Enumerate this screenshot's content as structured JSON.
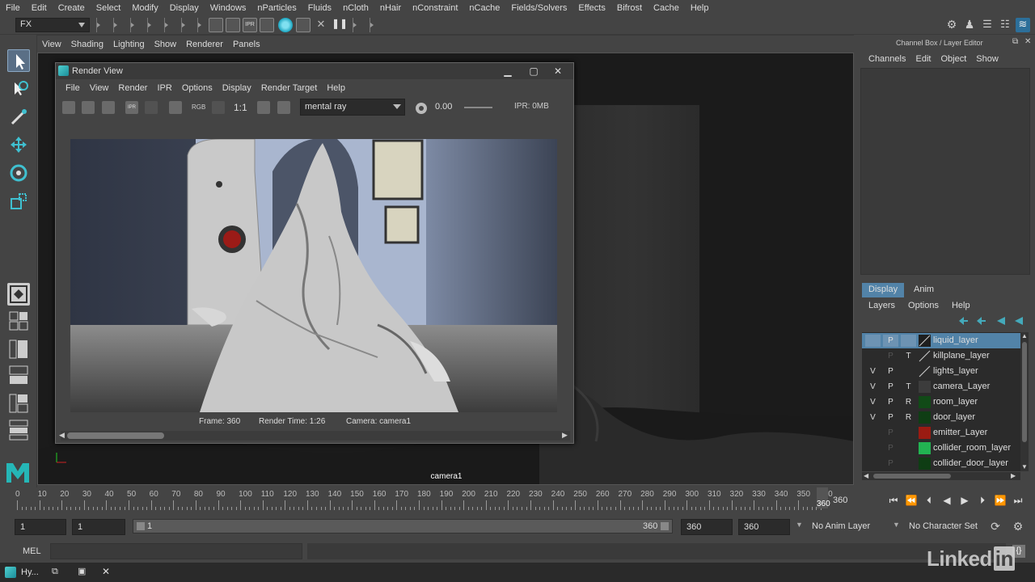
{
  "menubar": [
    "File",
    "Edit",
    "Create",
    "Select",
    "Modify",
    "Display",
    "Windows",
    "nParticles",
    "Fluids",
    "nCloth",
    "nHair",
    "nConstraint",
    "nCache",
    "Fields/Solvers",
    "Effects",
    "Bifrost",
    "Cache",
    "Help"
  ],
  "status": {
    "mode": "FX"
  },
  "viewport": {
    "menu": [
      "View",
      "Shading",
      "Lighting",
      "Show",
      "Renderer",
      "Panels"
    ],
    "camera_label": "camera1"
  },
  "render_view": {
    "title": "Render View",
    "menu": [
      "File",
      "View",
      "Render",
      "IPR",
      "Options",
      "Display",
      "Render Target",
      "Help"
    ],
    "rgb_label": "RGB",
    "ratio_label": "1:1",
    "renderer": "mental ray",
    "exposure": "0.00",
    "ipr_mem": "IPR: 0MB",
    "info": {
      "frame": "Frame: 360",
      "render_time": "Render Time: 1:26",
      "camera": "Camera: camera1"
    }
  },
  "channel_box": {
    "header": "Channel Box / Layer Editor",
    "menu": [
      "Channels",
      "Edit",
      "Object",
      "Show"
    ]
  },
  "layer_editor": {
    "tabs": [
      "Display",
      "Anim"
    ],
    "menu": [
      "Layers",
      "Options",
      "Help"
    ],
    "layers": [
      {
        "v": "",
        "p": "P",
        "t": "",
        "name": "liquid_layer",
        "color": "#1e1e1e",
        "selected": true
      },
      {
        "v": "",
        "p": "P",
        "t": "T",
        "name": "killplane_layer",
        "color": "#2b2b2b"
      },
      {
        "v": "V",
        "p": "P",
        "t": "",
        "name": "lights_layer",
        "color": "#2b2b2b"
      },
      {
        "v": "V",
        "p": "P",
        "t": "T",
        "name": "camera_Layer",
        "color": "#3c3c3c"
      },
      {
        "v": "V",
        "p": "P",
        "t": "R",
        "name": "room_layer",
        "color": "#114a17"
      },
      {
        "v": "V",
        "p": "P",
        "t": "R",
        "name": "door_layer",
        "color": "#0f3d14"
      },
      {
        "v": "",
        "p": "P",
        "t": "",
        "name": "emitter_Layer",
        "color": "#9a1b12"
      },
      {
        "v": "",
        "p": "P",
        "t": "",
        "name": "collider_room_layer",
        "color": "#22b352"
      },
      {
        "v": "",
        "p": "P",
        "t": "",
        "name": "collider_door_layer",
        "color": "#0f3d14"
      }
    ]
  },
  "timeline": {
    "ticks": [
      "0",
      "10",
      "20",
      "30",
      "40",
      "50",
      "60",
      "70",
      "80",
      "90",
      "100",
      "110",
      "120",
      "130",
      "140",
      "150",
      "160",
      "170",
      "180",
      "190",
      "200",
      "210",
      "220",
      "230",
      "240",
      "250",
      "260",
      "270",
      "280",
      "290",
      "300",
      "310",
      "320",
      "330",
      "340",
      "350",
      "360"
    ],
    "current_frame": "360",
    "current_marker": "360"
  },
  "range": {
    "start": "1",
    "anim_start": "1",
    "range_start_label": "1",
    "range_end_label": "360",
    "end": "360",
    "anim_end": "360",
    "anim_layer": "No Anim Layer",
    "char_set": "No Character Set"
  },
  "command": {
    "label": "MEL"
  },
  "taskbar": {
    "app": "Hy..."
  },
  "watermark": "Linked",
  "watermark_in": "in"
}
